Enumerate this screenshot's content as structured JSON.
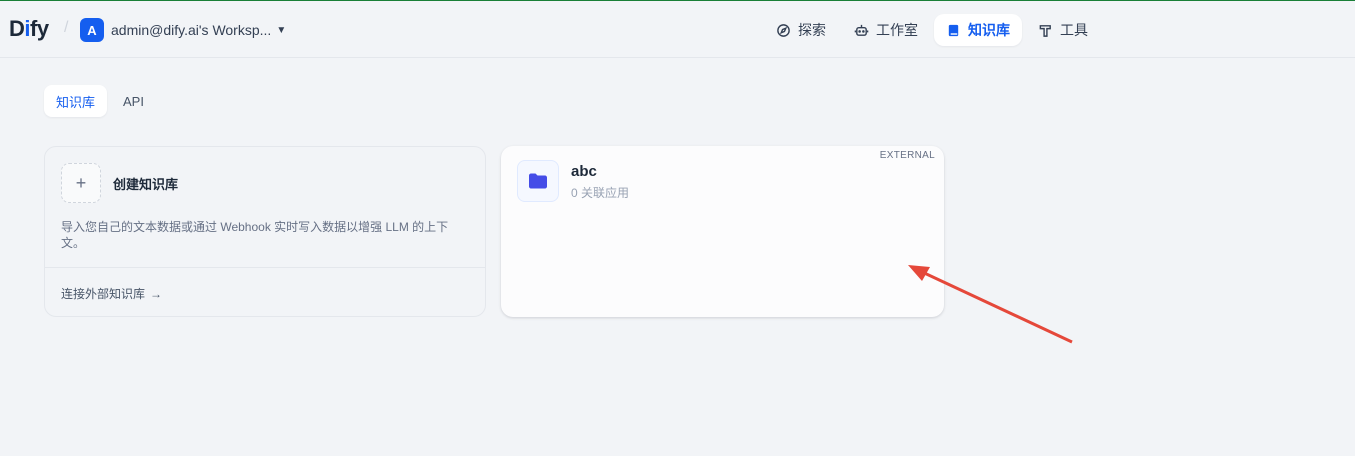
{
  "logo": {
    "prefix": "D",
    "mid": "i",
    "suffix": "fy"
  },
  "workspace": {
    "avatar_letter": "A",
    "name": "admin@dify.ai's Worksp..."
  },
  "nav": {
    "explore": "探索",
    "studio": "工作室",
    "knowledge": "知识库",
    "tools": "工具"
  },
  "tabs": {
    "knowledge": "知识库",
    "api": "API"
  },
  "create_card": {
    "title": "创建知识库",
    "description": "导入您自己的文本数据或通过 Webhook 实时写入数据以增强 LLM 的上下文。",
    "external_link": "连接外部知识库"
  },
  "dataset": {
    "badge": "EXTERNAL",
    "name": "abc",
    "meta": "0 关联应用"
  },
  "colors": {
    "accent": "#155eef",
    "annotation_arrow": "#e5483a",
    "folder_icon": "#444ce7"
  }
}
